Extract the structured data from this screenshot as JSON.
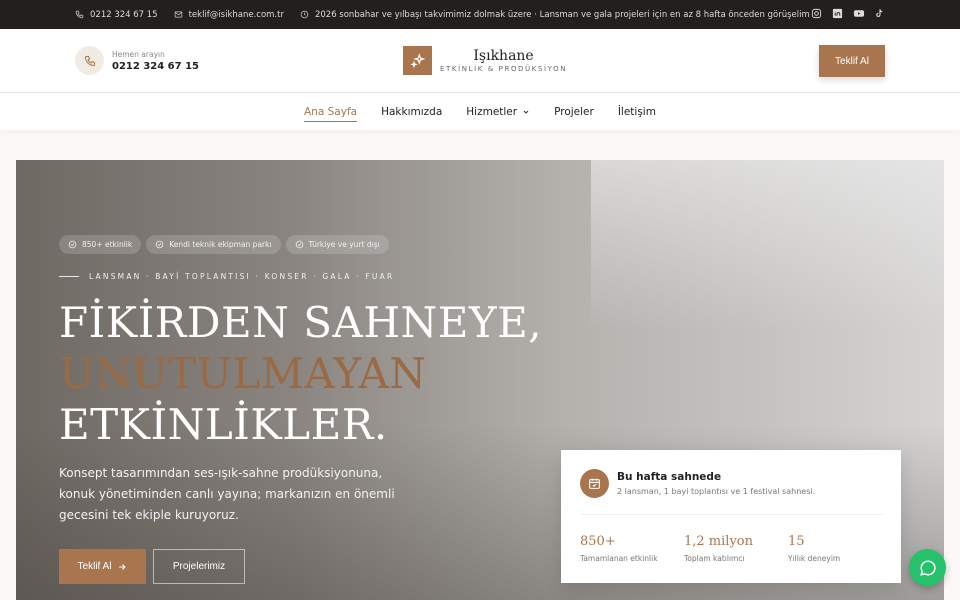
{
  "topbar": {
    "phone": "0212 324 67 15",
    "email": "teklif@isikhane.com.tr",
    "notice": "2026 sonbahar ve yılbaşı takvimimiz dolmak üzere · Lansman ve gala projeleri için en az 8 hafta önceden görüşelim",
    "social": [
      "instagram-icon",
      "linkedin-icon",
      "youtube-icon",
      "tiktok-icon"
    ]
  },
  "header": {
    "call_label": "Hemen arayın",
    "call_number": "0212 324 67 15",
    "logo_name": "Işıkhane",
    "logo_sub": "ETKİNLİK & PRODÜKSİYON",
    "cta": "Teklif Al"
  },
  "nav": {
    "items": [
      {
        "label": "Ana Sayfa",
        "active": true
      },
      {
        "label": "Hakkımızda"
      },
      {
        "label": "Hizmetler",
        "dropdown": true
      },
      {
        "label": "Projeler"
      },
      {
        "label": "İletişim"
      }
    ]
  },
  "hero": {
    "tags": [
      "850+ etkinlik",
      "Kendi teknik ekipman parkı",
      "Türkiye ve yurt dışı"
    ],
    "kicker": "LANSMAN · BAYİ TOPLANTISI · KONSER · GALA · FUAR",
    "title_line1": "FİKİRDEN SAHNEYE,",
    "title_line2": "UNUTULMAYAN",
    "title_line3": "ETKİNLİKLER.",
    "description": "Konsept tasarımından ses-ışık-sahne prodüksiyonuna, konuk yönetiminden canlı yayına; markanızın en önemli gecesini tek ekiple kuruyoruz.",
    "primary_button": "Teklif Al",
    "secondary_button": "Projelerimiz"
  },
  "card": {
    "title": "Bu hafta sahnede",
    "subtitle": "2 lansman, 1 bayi toplantısı ve 1 festival sahnesi.",
    "stats": [
      {
        "value": "850+",
        "label": "Tamamlanan etkinlik"
      },
      {
        "value": "1,2 milyon",
        "label": "Toplam katılımcı"
      },
      {
        "value": "15",
        "label": "Yıllık deneyim"
      }
    ]
  },
  "colors": {
    "accent": "#a8754e",
    "topbar": "#221f1c",
    "chat": "#25c26a"
  }
}
